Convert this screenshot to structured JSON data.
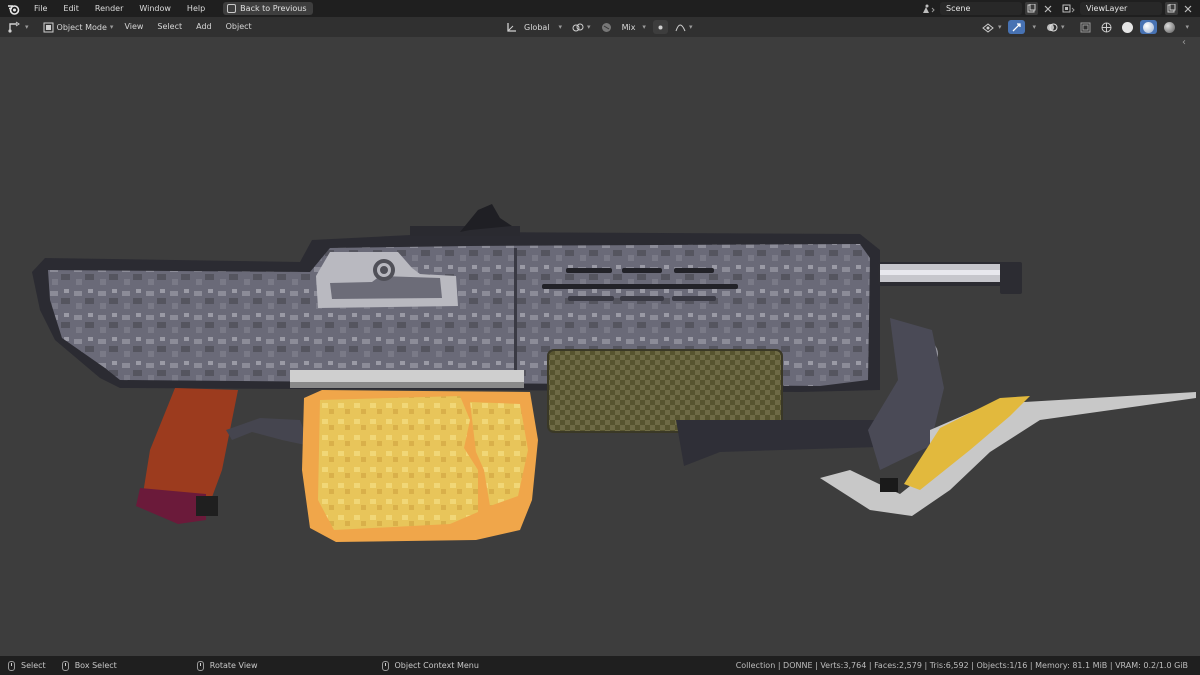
{
  "topbar": {
    "menu": [
      "File",
      "Edit",
      "Render",
      "Window",
      "Help"
    ],
    "back_button": "Back to Previous",
    "scene_field": "Scene",
    "view_layer_field": "ViewLayer"
  },
  "header": {
    "mode": "Object Mode",
    "menus": [
      "View",
      "Select",
      "Add",
      "Object"
    ],
    "transform_orientation": "Global",
    "proportional": "Mix",
    "viewport_shading": "solid"
  },
  "statusbar": {
    "select": "Select",
    "box_select": "Box Select",
    "rotate_view": "Rotate View",
    "context_menu": "Object Context Menu",
    "stats": "Collection | DONNE | Verts:3,764 | Faces:2,579 | Tris:6,592 | Objects:1/16 | Memory: 81.1 MiB | VRAM: 0.2/1.0 GiB"
  },
  "colors": {
    "accent": "#4772b3",
    "viewport_bg": "#3d3d3d",
    "gun_body": "#5d5d6a",
    "magazine": "#e7c35a",
    "grip": "#9c3b1e",
    "foregrip": "#6b6640",
    "blade": "#c8c8c8"
  }
}
